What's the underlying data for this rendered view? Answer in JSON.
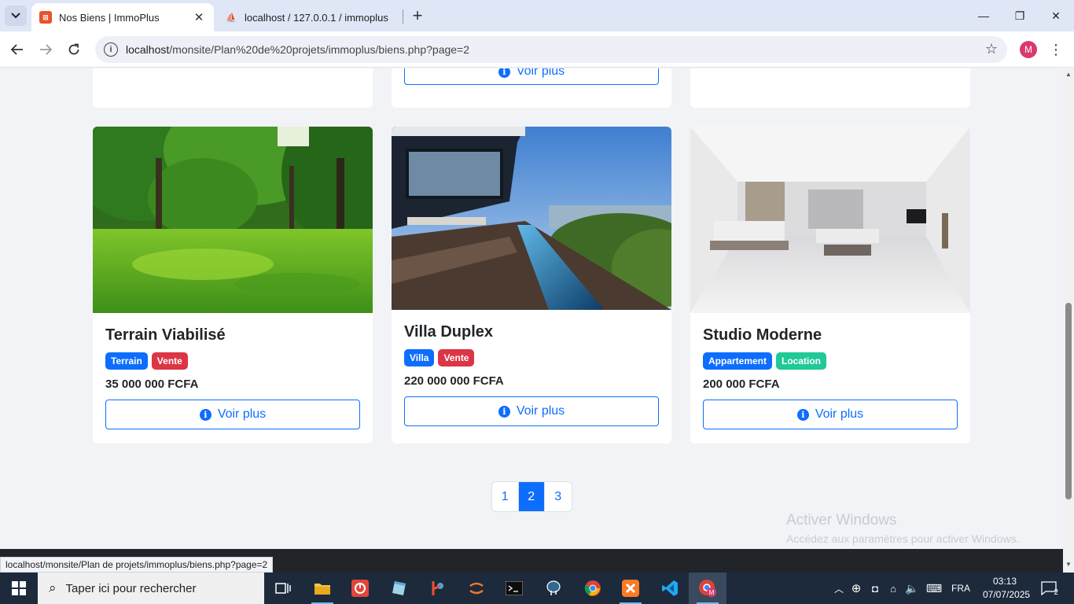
{
  "browser": {
    "tabs": [
      {
        "title": "Nos Biens | ImmoPlus",
        "favicon_color": "#e8532a"
      },
      {
        "title": "localhost / 127.0.0.1 / immoplus",
        "favicon_color": "#f4a61d"
      }
    ],
    "address": {
      "host": "localhost",
      "path": "/monsite/Plan%20de%20projets/immoplus/biens.php?page=2"
    },
    "profile_initial": "M",
    "status_url": "localhost/monsite/Plan de projets/immoplus/biens.php?page=2"
  },
  "page": {
    "top_button_label": "Voir plus",
    "properties": [
      {
        "title": "Terrain Viabilisé",
        "badges": [
          {
            "label": "Terrain",
            "color": "#0d6efd"
          },
          {
            "label": "Vente",
            "color": "#dc3545"
          }
        ],
        "price": "35 000 000 FCFA",
        "button_label": "Voir plus",
        "image": "green park lawn with trees"
      },
      {
        "title": "Villa Duplex",
        "badges": [
          {
            "label": "Villa",
            "color": "#0d6efd"
          },
          {
            "label": "Vente",
            "color": "#dc3545"
          }
        ],
        "price": "220 000 000 FCFA",
        "button_label": "Voir plus",
        "image": "modern villa with infinity pool"
      },
      {
        "title": "Studio Moderne",
        "badges": [
          {
            "label": "Appartement",
            "color": "#0d6efd"
          },
          {
            "label": "Location",
            "color": "#20c997"
          }
        ],
        "price": "200 000 FCFA",
        "button_label": "Voir plus",
        "image": "bright white bedroom interior"
      }
    ],
    "pagination": [
      "1",
      "2",
      "3"
    ],
    "current_page": "2"
  },
  "watermark": {
    "title": "Activer Windows",
    "subtitle": "Accédez aux paramètres pour activer Windows."
  },
  "taskbar": {
    "search_placeholder": "Taper ici pour rechercher",
    "language": "FRA",
    "time": "03:13",
    "date": "07/07/2025",
    "notification_count": "2"
  }
}
